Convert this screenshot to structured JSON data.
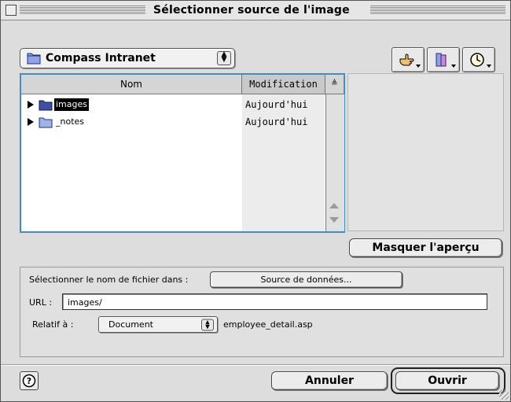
{
  "window": {
    "title": "Sélectionner source de l'image"
  },
  "location_popup": {
    "selected": "Compass Intranet",
    "icon": "folder-icon"
  },
  "toolbar_icons": [
    "hand-shortcut-icon",
    "favorites-icon",
    "recent-clock-icon"
  ],
  "file_list": {
    "headers": {
      "name": "Nom",
      "modified": "Modification",
      "sort": "≜"
    },
    "items": [
      {
        "name": "images",
        "modified": "Aujourd'hui",
        "selected": true
      },
      {
        "name": "_notes",
        "modified": "Aujourd'hui",
        "selected": false
      }
    ]
  },
  "preview_button": "Masquer l'aperçu",
  "options": {
    "select_label": "Sélectionner le nom de fichier dans :",
    "datasource_button": "Source de données...",
    "url_label": "URL :",
    "url_value": "images/",
    "relative_label": "Relatif à :",
    "relative_value": "Document",
    "relative_file": "employee_detail.asp"
  },
  "footer": {
    "help": "?",
    "cancel": "Annuler",
    "open": "Ouvrir"
  },
  "colors": {
    "list_focus": "#3f8fc4",
    "folder": "#5a72c8"
  }
}
